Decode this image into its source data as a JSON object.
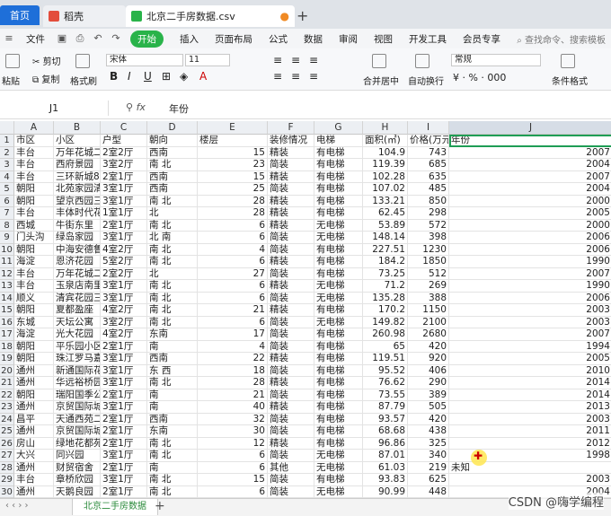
{
  "tabs": [
    {
      "label": "首页"
    },
    {
      "label": "稻壳"
    },
    {
      "label": "北京二手房数据.csv"
    }
  ],
  "menu": [
    "文件",
    "开始",
    "插入",
    "页面布局",
    "公式",
    "数据",
    "审阅",
    "视图",
    "开发工具",
    "会员专享"
  ],
  "search_placeholder": "查找命令、搜索模板",
  "ribbon": {
    "paste": "粘贴",
    "cut": "剪切",
    "copy": "复制",
    "format_painter": "格式刷",
    "font": "宋体",
    "size": "11",
    "merge": "合并居中",
    "wrap": "自动换行",
    "number_format": "常规",
    "cond_format": "条件格式"
  },
  "formula_bar": {
    "cell_ref": "J1",
    "value": "年份"
  },
  "columns": [
    "A",
    "B",
    "C",
    "D",
    "E",
    "F",
    "G",
    "H",
    "I",
    "J"
  ],
  "rows": [
    [
      "市区",
      "小区",
      "户型",
      "朝向",
      "楼层",
      "装修情况",
      "电梯",
      "面积(㎡)",
      "价格(万元)",
      "年份"
    ],
    [
      "丰台",
      "万年花城二期",
      "2室2厅",
      "西南",
      "15",
      "精装",
      "有电梯",
      "104.9",
      "743",
      "2007"
    ],
    [
      "丰台",
      "西府景园",
      "3室2厅",
      "南 北",
      "23",
      "简装",
      "有电梯",
      "119.39",
      "685",
      "2004"
    ],
    [
      "丰台",
      "三环新城8号院",
      "2室1厅",
      "西南",
      "15",
      "精装",
      "有电梯",
      "102.28",
      "635",
      "2007"
    ],
    [
      "朝阳",
      "北苑家园清友园",
      "3室1厅",
      "西南",
      "25",
      "简装",
      "有电梯",
      "107.02",
      "485",
      "2004"
    ],
    [
      "朝阳",
      "望京西园三区",
      "3室1厅",
      "南 北",
      "28",
      "精装",
      "有电梯",
      "133.21",
      "850",
      "2000"
    ],
    [
      "丰台",
      "丰体时代花园",
      "1室1厅",
      "北",
      "28",
      "精装",
      "有电梯",
      "62.45",
      "298",
      "2005"
    ],
    [
      "西城",
      "牛街东里",
      "2室1厅",
      "南 北",
      "6",
      "精装",
      "无电梯",
      "53.89",
      "572",
      "2000"
    ],
    [
      "门头沟",
      "绿岛家园",
      "3室1厅",
      "北 南",
      "6",
      "简装",
      "无电梯",
      "148.14",
      "398",
      "2006"
    ],
    [
      "朝阳",
      "中海安德鲁斯",
      "4室2厅",
      "南 北",
      "4",
      "简装",
      "有电梯",
      "227.51",
      "1230",
      "2006"
    ],
    [
      "海淀",
      "恩济花园",
      "5室2厅",
      "南 北",
      "6",
      "精装",
      "有电梯",
      "184.2",
      "1850",
      "1990"
    ],
    [
      "丰台",
      "万年花城二期",
      "2室2厅",
      "北",
      "27",
      "简装",
      "有电梯",
      "73.25",
      "512",
      "2007"
    ],
    [
      "丰台",
      "玉泉店南里",
      "3室1厅",
      "南 北",
      "6",
      "精装",
      "无电梯",
      "71.2",
      "269",
      "1990"
    ],
    [
      "顺义",
      "清宾花园三区",
      "3室1厅",
      "南 北",
      "6",
      "简装",
      "无电梯",
      "135.28",
      "388",
      "2006"
    ],
    [
      "朝阳",
      "夏都盈座",
      "4室2厅",
      "南 北",
      "21",
      "精装",
      "有电梯",
      "170.2",
      "1150",
      "2003"
    ],
    [
      "东城",
      "天坛公寓",
      "3室2厅",
      "南 北",
      "6",
      "简装",
      "无电梯",
      "149.82",
      "2100",
      "2003"
    ],
    [
      "海淀",
      "光大花园",
      "4室2厅",
      "东南",
      "17",
      "简装",
      "有电梯",
      "260.98",
      "2680",
      "2007"
    ],
    [
      "朝阳",
      "平乐园小区",
      "2室1厅",
      "南",
      "4",
      "简装",
      "有电梯",
      "65",
      "420",
      "1994"
    ],
    [
      "朝阳",
      "珠江罗马嘉园",
      "3室1厅",
      "西南",
      "22",
      "精装",
      "有电梯",
      "119.51",
      "920",
      "2005"
    ],
    [
      "通州",
      "新通国际花园",
      "3室1厅",
      "东 西",
      "18",
      "简装",
      "有电梯",
      "95.52",
      "406",
      "2010"
    ],
    [
      "通州",
      "华远裕桥园",
      "3室1厅",
      "南 北",
      "28",
      "精装",
      "有电梯",
      "76.62",
      "290",
      "2014"
    ],
    [
      "朝阳",
      "瑞阳国季公寓",
      "2室1厅",
      "南",
      "21",
      "简装",
      "有电梯",
      "73.55",
      "389",
      "2014"
    ],
    [
      "通州",
      "京贸国际城",
      "3室1厅",
      "南",
      "40",
      "精装",
      "有电梯",
      "87.79",
      "505",
      "2013"
    ],
    [
      "昌平",
      "天通西苑二区",
      "2室1厅",
      "西南",
      "32",
      "简装",
      "有电梯",
      "93.57",
      "420",
      "2003"
    ],
    [
      "通州",
      "京贸国际城",
      "2室1厅",
      "东南",
      "30",
      "简装",
      "有电梯",
      "68.68",
      "438",
      "2011"
    ],
    [
      "房山",
      "绿地花都苑",
      "2室1厅",
      "南 北",
      "12",
      "精装",
      "有电梯",
      "96.86",
      "325",
      "2012"
    ],
    [
      "大兴",
      "同兴园",
      "3室1厅",
      "南 北",
      "6",
      "简装",
      "无电梯",
      "87.01",
      "340",
      "1998"
    ],
    [
      "通州",
      "财贸宿舍",
      "2室1厅",
      "南",
      "6",
      "其他",
      "无电梯",
      "61.03",
      "219",
      "未知"
    ],
    [
      "丰台",
      "章桥欣园",
      "3室1厅",
      "南 北",
      "15",
      "简装",
      "有电梯",
      "93.83",
      "625",
      "2003"
    ],
    [
      "通州",
      "天鹅良园",
      "2室1厅",
      "南 北",
      "6",
      "简装",
      "无电梯",
      "90.99",
      "448",
      "2004"
    ],
    [
      "海淀",
      "田村33号院",
      "3室1厅",
      "南 北",
      "6",
      "简装",
      "无电梯",
      "134.1",
      "720",
      "2000"
    ]
  ],
  "sheet_tab": "北京二手房数据",
  "watermark": "CSDN @嗨学编程",
  "colors": {
    "accent": "#29b34a",
    "home_tab": "#1e6fd9",
    "active_border": "#1f9d55"
  }
}
